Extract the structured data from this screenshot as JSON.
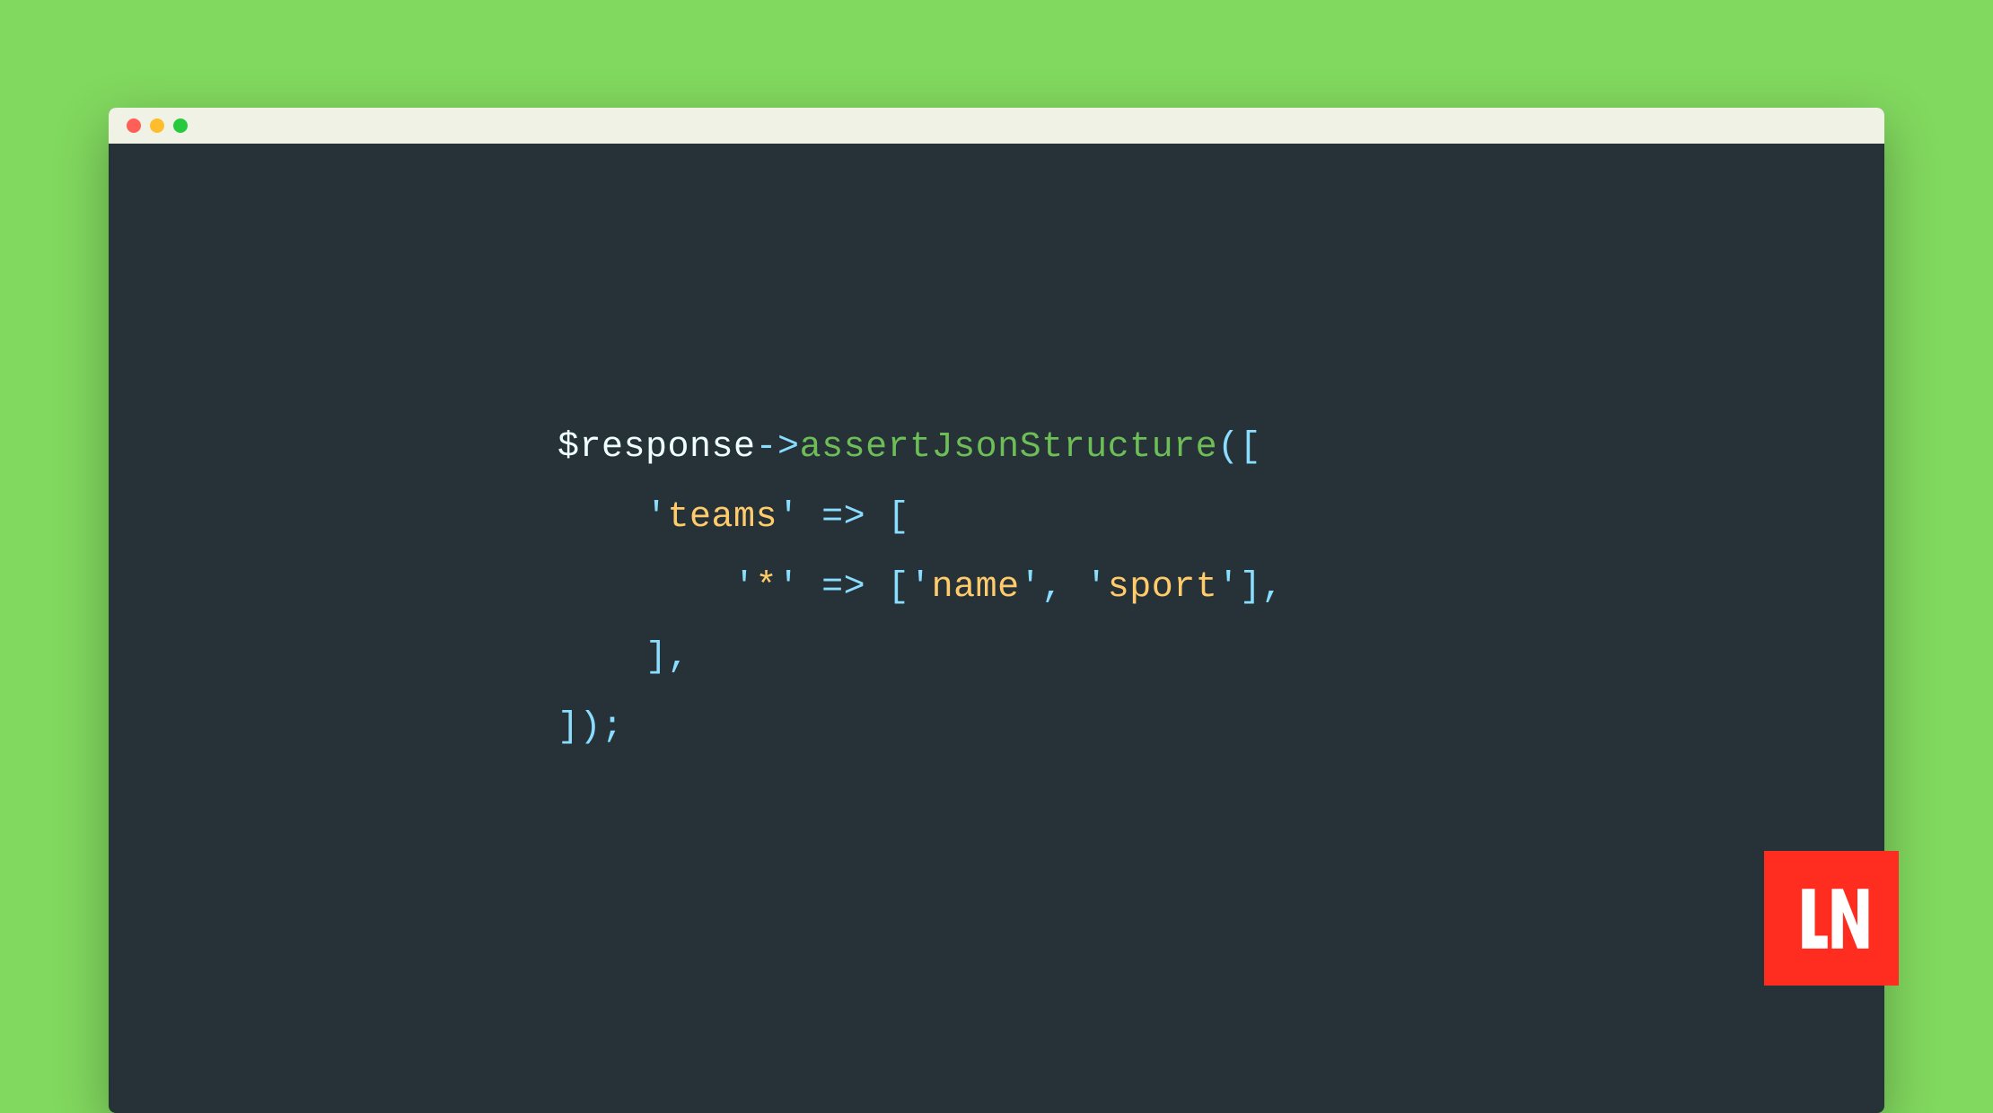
{
  "window": {
    "traffic_lights": [
      "close",
      "minimize",
      "maximize"
    ]
  },
  "code": {
    "line1": {
      "variable": "$response",
      "arrow": "->",
      "method": "assertJsonStructure",
      "open": "(["
    },
    "line2": {
      "indent": "    ",
      "quote1": "'",
      "key": "teams",
      "quote2": "'",
      "fat_arrow": " => ",
      "bracket": "["
    },
    "line3": {
      "indent": "        ",
      "quote1": "'",
      "key": "*",
      "quote2": "'",
      "fat_arrow": " => ",
      "open": "[",
      "quote3": "'",
      "val1": "name",
      "quote4": "'",
      "comma1": ", ",
      "quote5": "'",
      "val2": "sport",
      "quote6": "'",
      "close": "],"
    },
    "line4": {
      "indent": "    ",
      "close": "],"
    },
    "line5": {
      "close": "]);"
    }
  },
  "logo": {
    "name": "LN"
  }
}
